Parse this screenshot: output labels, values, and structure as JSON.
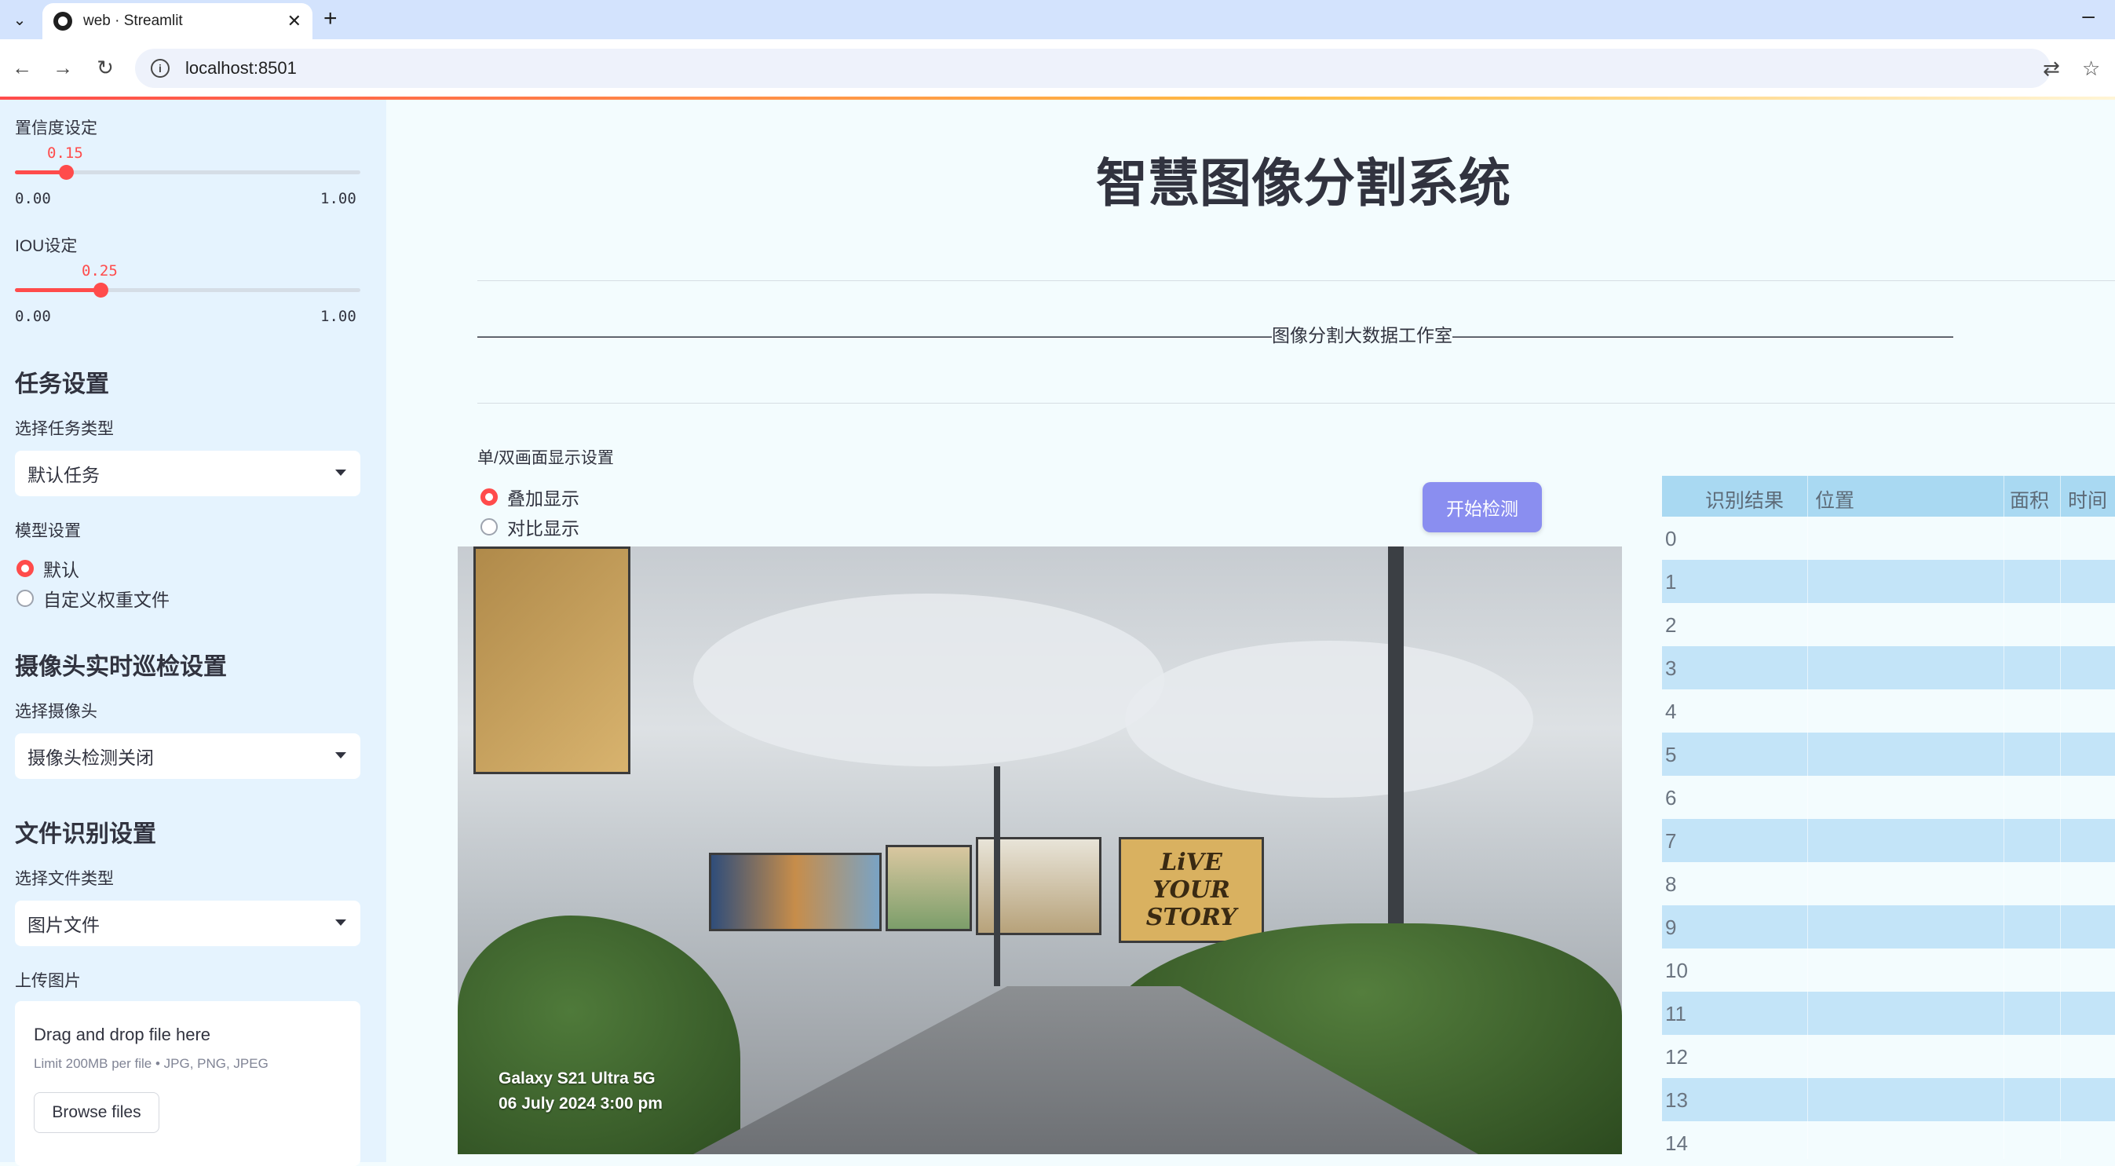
{
  "browser": {
    "tab_title": "web · Streamlit",
    "url": "localhost:8501"
  },
  "sidebar": {
    "confidence": {
      "label": "置信度设定",
      "value": "0.15",
      "min": "0.00",
      "max": "1.00",
      "fraction": 0.15
    },
    "iou": {
      "label": "IOU设定",
      "value": "0.25",
      "min": "0.00",
      "max": "1.00",
      "fraction": 0.25
    },
    "task_section": "任务设置",
    "task_type_label": "选择任务类型",
    "task_type_value": "默认任务",
    "model_label": "模型设置",
    "model_options": [
      "默认",
      "自定义权重文件"
    ],
    "model_selected": "默认",
    "camera_section": "摄像头实时巡检设置",
    "camera_label": "选择摄像头",
    "camera_value": "摄像头检测关闭",
    "file_section": "文件识别设置",
    "file_type_label": "选择文件类型",
    "file_type_value": "图片文件",
    "upload_label": "上传图片",
    "upload_title": "Drag and drop file here",
    "upload_limit": "Limit 200MB per file • JPG, PNG, JPEG",
    "browse_label": "Browse files"
  },
  "main": {
    "title": "智慧图像分割系统",
    "banner": "————————————————————————————————————————————图像分割大数据工作室——————————————————————————————————————————————",
    "display_mode_label": "单/双画面显示设置",
    "display_options": [
      "叠加显示",
      "对比显示"
    ],
    "display_selected": "叠加显示",
    "detect_button": "开始检测",
    "photo_watermark_line1": "Galaxy S21 Ultra 5G",
    "photo_watermark_line2": "06 July 2024 3:00 pm",
    "billboard_text": "LiVE YOUR STORY"
  },
  "table": {
    "headers": [
      "识别结果",
      "位置",
      "面积",
      "时间"
    ],
    "rows": [
      "0",
      "1",
      "2",
      "3",
      "4",
      "5",
      "6",
      "7",
      "8",
      "9",
      "10",
      "11",
      "12",
      "13",
      "14"
    ]
  },
  "colors": {
    "accent": "#ff4b4b",
    "sidebar_bg": "#e5f3fe",
    "main_bg": "#f3fcfe",
    "button": "#8a8ef0",
    "table_header": "#a9d9f2",
    "table_alt": "#c3e4f8"
  }
}
